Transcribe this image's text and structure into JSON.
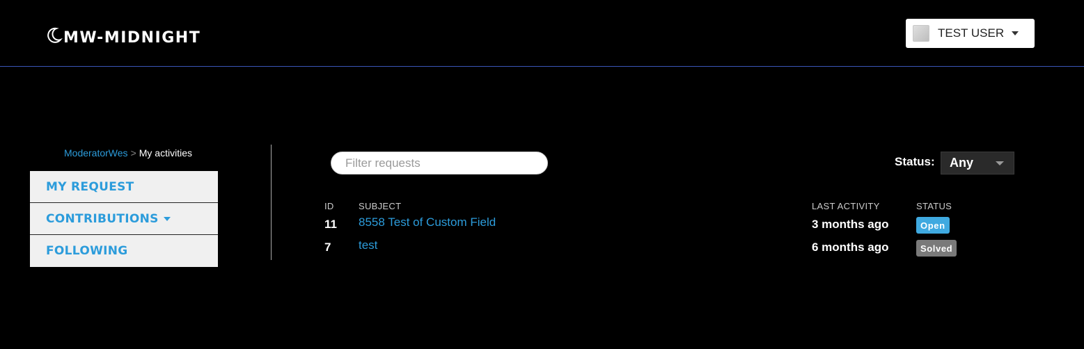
{
  "header": {
    "logo_text": "MW-MIDNIGHT",
    "logo_icon": "moon-icon",
    "user_name": "TEST USER"
  },
  "breadcrumb": {
    "parent": "ModeratorWes",
    "separator": ">",
    "current": "My activities"
  },
  "sidebar": {
    "items": [
      {
        "label": "MY REQUEST"
      },
      {
        "label": "CONTRIBUTIONS"
      },
      {
        "label": "FOLLOWING"
      }
    ]
  },
  "filter": {
    "placeholder": "Filter requests",
    "value": ""
  },
  "status_filter": {
    "label": "Status:",
    "selected": "Any"
  },
  "table": {
    "headers": {
      "id": "ID",
      "subject": "SUBJECT",
      "last_activity": "LAST ACTIVITY",
      "status": "STATUS"
    },
    "rows": [
      {
        "id": "11",
        "subject": "8558 Test of Custom Field",
        "last_activity": "3 months ago",
        "status": "Open",
        "status_color": "#3fa9e0"
      },
      {
        "id": "7",
        "subject": "test",
        "last_activity": "6 months ago",
        "status": "Solved",
        "status_color": "#7a7a7a"
      }
    ]
  },
  "colors": {
    "accent": "#2c9cdb",
    "background": "#000000",
    "header_border": "#3a56b8"
  }
}
